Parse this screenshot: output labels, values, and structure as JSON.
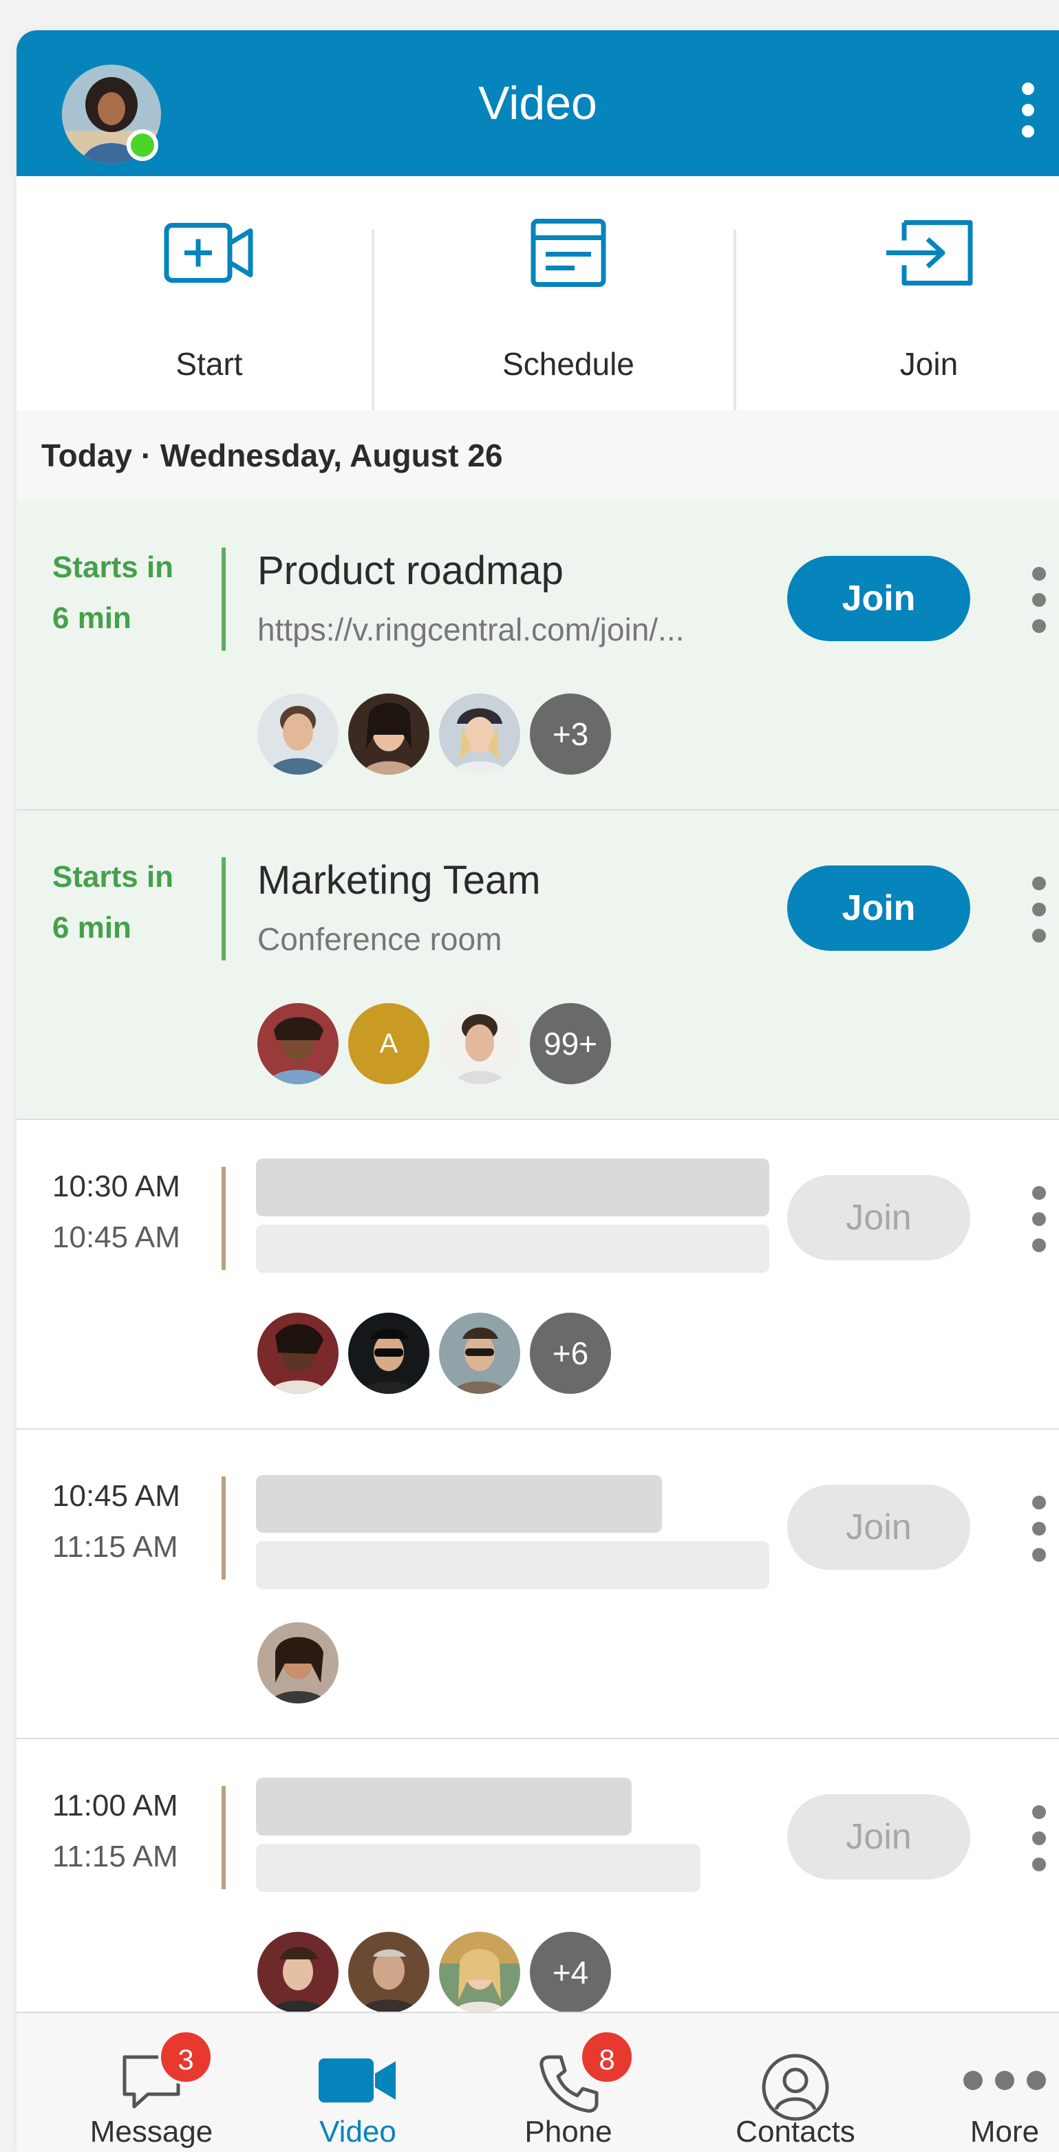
{
  "header": {
    "title": "Video",
    "presence": "online",
    "menu_icon": "more-vertical-icon"
  },
  "actions": [
    {
      "label": "Start",
      "icon": "video-add-icon"
    },
    {
      "label": "Schedule",
      "icon": "calendar-schedule-icon"
    },
    {
      "label": "Join",
      "icon": "join-arrow-icon"
    }
  ],
  "date_heading": "Today · Wednesday, August 26",
  "join_label": "Join",
  "meetings": [
    {
      "time_line1": "Starts in",
      "time_line2": "6 min",
      "title": "Product roadmap",
      "subtitle": "https://v.ringcentral.com/join/...",
      "more_count": "+3",
      "state": "starting-soon"
    },
    {
      "time_line1": "Starts in",
      "time_line2": "6 min",
      "title": "Marketing Team",
      "subtitle": "Conference room",
      "initial": "A",
      "more_count": "99+",
      "state": "starting-soon"
    },
    {
      "time_line1": "10:30 AM",
      "time_line2": "10:45 AM",
      "more_count": "+6",
      "state": "loading"
    },
    {
      "time_line1": "10:45 AM",
      "time_line2": "11:15 AM",
      "state": "loading"
    },
    {
      "time_line1": "11:00 AM",
      "time_line2": "11:15 AM",
      "more_count": "+4",
      "state": "loading"
    }
  ],
  "bottom_nav": [
    {
      "label": "Message",
      "icon": "message-icon",
      "badge": "3"
    },
    {
      "label": "Video",
      "icon": "video-camera-icon",
      "active": true
    },
    {
      "label": "Phone",
      "icon": "phone-icon",
      "badge": "8"
    },
    {
      "label": "Contacts",
      "icon": "contacts-icon"
    },
    {
      "label": "More",
      "icon": "more-horizontal-icon"
    }
  ],
  "colors": {
    "brand": "#0684bc",
    "soon_green": "#45a04b",
    "badge_red": "#e8392f",
    "presence_green": "#4bd52a"
  }
}
